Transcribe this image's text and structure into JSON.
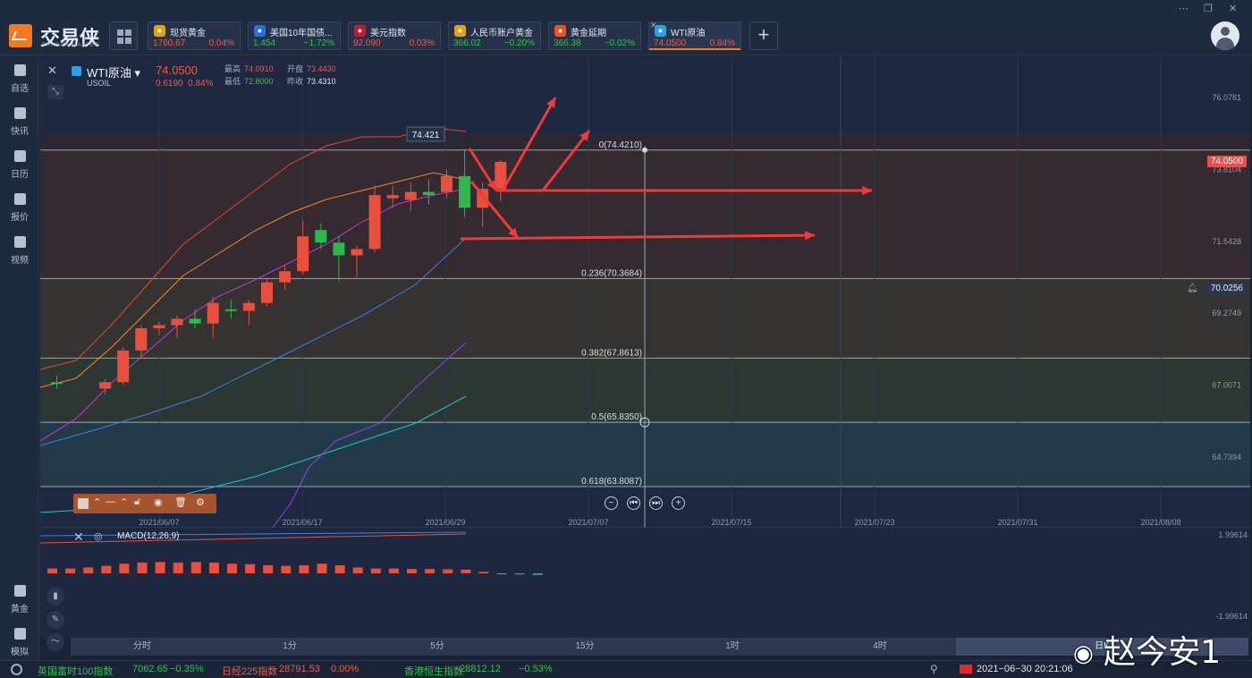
{
  "app": {
    "brand_name": "交易侠",
    "brand_sub": "TRADER MASTER"
  },
  "tabs": [
    {
      "name": "现货黄金",
      "price": "1760.67",
      "change": "0.04%",
      "dir": "up",
      "icon": "gold-coin-icon",
      "color": "#d9a520"
    },
    {
      "name": "美国10年国债...",
      "price": "1.454",
      "change": "−1.72%",
      "dir": "down",
      "icon": "bar-chart-icon",
      "color": "#2d6fd6"
    },
    {
      "name": "美元指数",
      "price": "92.090",
      "change": "0.03%",
      "dir": "up",
      "icon": "us-flag-icon",
      "color": "#b22234"
    },
    {
      "name": "人民币账户黄金",
      "price": "366.02",
      "change": "−0.20%",
      "dir": "down",
      "icon": "gold-coin-icon",
      "color": "#d9a520"
    },
    {
      "name": "黄金延期",
      "price": "366.38",
      "change": "−0.02%",
      "dir": "down",
      "icon": "gold-bar-icon",
      "color": "#e0572a"
    },
    {
      "name": "WTI原油",
      "price": "74.0500",
      "change": "0.84%",
      "dir": "up",
      "icon": "oil-icon",
      "color": "#2f9fe0",
      "active": true
    }
  ],
  "sidebar": [
    {
      "label": "自选",
      "icon": "bookmark-icon"
    },
    {
      "label": "快讯",
      "icon": "news-icon"
    },
    {
      "label": "日历",
      "icon": "calendar-icon"
    },
    {
      "label": "报价",
      "icon": "trend-icon"
    },
    {
      "label": "视频",
      "icon": "video-icon"
    },
    {
      "label": "黄金",
      "icon": "gold-icon"
    },
    {
      "label": "模拟",
      "icon": "wallet-icon"
    }
  ],
  "instrument": {
    "name": "WTI原油",
    "code": "USOIL",
    "price": "74.0500",
    "change_abs": "0.6190",
    "change_pct": "0.84%",
    "stats": {
      "high_label": "最高",
      "high": "74.0910",
      "open_label": "开盘",
      "open": "73.4430",
      "low_label": "最低",
      "low": "72.8000",
      "prev_label": "昨收",
      "prev": "73.4310"
    }
  },
  "price_axis": {
    "ticks": [
      "76.0781",
      "73.8104",
      "71.5428",
      "69.2749",
      "67.0071",
      "64.7394"
    ],
    "current_tag": "74.0500",
    "alert_tag": "70.0256",
    "macd_ticks": [
      "1.99614",
      "-1.99614"
    ]
  },
  "fib": [
    {
      "label": "0(74.4210)",
      "price": 74.421,
      "color": "#d0b8a8"
    },
    {
      "label": "0.236(70.3684)",
      "price": 70.3684,
      "color": "#c2c2b0"
    },
    {
      "label": "0.382(67.8613)",
      "price": 67.8613,
      "color": "#a8c2a8"
    },
    {
      "label": "0.5(65.8350)",
      "price": 65.835,
      "color": "#a8c6d8"
    },
    {
      "label": "0.618(63.8087)",
      "price": 63.8087,
      "color": "#b8c0dc"
    }
  ],
  "peak_label": "74.421",
  "date_axis": [
    "2021/06/07",
    "2021/06/17",
    "2021/06/29",
    "2021/07/07",
    "2021/07/15",
    "2021/07/23",
    "2021/07/31",
    "2021/08/08"
  ],
  "macd": {
    "label": "MACD(12,26,9)"
  },
  "timeframes": [
    "分时",
    "1分",
    "5分",
    "15分",
    "1时",
    "4时",
    "日K"
  ],
  "active_timeframe": "日K",
  "chart_data": {
    "type": "candlestick",
    "candles": [
      {
        "o": 67.1,
        "h": 67.3,
        "l": 66.9,
        "c": 67.05
      },
      {
        "o": 66.9,
        "h": 67.2,
        "l": 66.7,
        "c": 67.1
      },
      {
        "o": 67.1,
        "h": 68.2,
        "l": 67.0,
        "c": 68.1
      },
      {
        "o": 68.1,
        "h": 68.9,
        "l": 67.9,
        "c": 68.8
      },
      {
        "o": 68.8,
        "h": 69.0,
        "l": 68.6,
        "c": 68.9
      },
      {
        "o": 68.9,
        "h": 69.2,
        "l": 68.5,
        "c": 69.1
      },
      {
        "o": 69.1,
        "h": 69.4,
        "l": 68.8,
        "c": 68.95
      },
      {
        "o": 68.95,
        "h": 69.8,
        "l": 68.5,
        "c": 69.6
      },
      {
        "o": 69.4,
        "h": 69.7,
        "l": 69.1,
        "c": 69.35
      },
      {
        "o": 69.35,
        "h": 69.7,
        "l": 68.9,
        "c": 69.6
      },
      {
        "o": 69.6,
        "h": 70.4,
        "l": 69.5,
        "c": 70.25
      },
      {
        "o": 70.25,
        "h": 70.8,
        "l": 70.0,
        "c": 70.6
      },
      {
        "o": 70.6,
        "h": 72.2,
        "l": 70.5,
        "c": 71.7
      },
      {
        "o": 71.9,
        "h": 72.1,
        "l": 71.3,
        "c": 71.5
      },
      {
        "o": 71.5,
        "h": 71.7,
        "l": 70.3,
        "c": 71.1
      },
      {
        "o": 71.1,
        "h": 71.4,
        "l": 70.4,
        "c": 71.3
      },
      {
        "o": 71.3,
        "h": 73.3,
        "l": 71.2,
        "c": 73.0
      },
      {
        "o": 72.9,
        "h": 73.3,
        "l": 72.6,
        "c": 73.0
      },
      {
        "o": 72.85,
        "h": 73.4,
        "l": 72.5,
        "c": 73.1
      },
      {
        "o": 73.1,
        "h": 73.5,
        "l": 72.7,
        "c": 73.0
      },
      {
        "o": 73.1,
        "h": 73.8,
        "l": 72.9,
        "c": 73.6
      },
      {
        "o": 73.6,
        "h": 74.42,
        "l": 72.3,
        "c": 72.6
      },
      {
        "o": 72.6,
        "h": 73.4,
        "l": 72.0,
        "c": 73.2
      },
      {
        "o": 73.2,
        "h": 74.1,
        "l": 72.8,
        "c": 74.05
      }
    ],
    "macd_hist": [
      0.45,
      0.45,
      0.55,
      0.7,
      0.9,
      1.0,
      1.05,
      1.0,
      1.05,
      1.0,
      0.9,
      0.85,
      0.75,
      0.7,
      0.75,
      0.9,
      0.75,
      0.55,
      0.45,
      0.45,
      0.4,
      0.4,
      0.38,
      0.35,
      0.15,
      -0.1,
      -0.1,
      -0.15
    ]
  },
  "ticker": [
    {
      "name": "英国富时100指数",
      "price": "7062.65",
      "change": "−0.35%",
      "dir": "down"
    },
    {
      "name": "日经225指数",
      "price": "28791.53",
      "change": "0.00%",
      "dir": "up"
    },
    {
      "name": "香港恒生指数",
      "price": "28812.12",
      "change": "−0.53%",
      "dir": "down"
    }
  ],
  "datetime": "2021−06−30 20:21:06",
  "watermark": "赵今安1"
}
